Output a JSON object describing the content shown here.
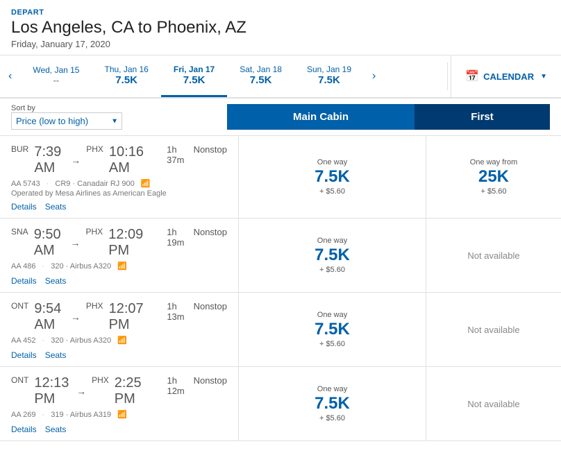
{
  "header": {
    "depart_label": "DEPART",
    "route": "Los Angeles, CA to Phoenix, AZ",
    "date": "Friday, January 17, 2020"
  },
  "date_nav": {
    "prev_arrow": "‹",
    "next_arrow": "›",
    "dates": [
      {
        "id": "wed-jan-15",
        "label": "Wed, Jan 15",
        "price": "--",
        "active": false,
        "price_dashes": true
      },
      {
        "id": "thu-jan-16",
        "label": "Thu, Jan 16",
        "price": "7.5K",
        "active": false,
        "price_dashes": false
      },
      {
        "id": "fri-jan-17",
        "label": "Fri, Jan 17",
        "price": "7.5K",
        "active": true,
        "price_dashes": false
      },
      {
        "id": "sat-jan-18",
        "label": "Sat, Jan 18",
        "price": "7.5K",
        "active": false,
        "price_dashes": false
      },
      {
        "id": "sun-jan-19",
        "label": "Sun, Jan 19",
        "price": "7.5K",
        "active": false,
        "price_dashes": false
      }
    ],
    "calendar_label": "CALENDAR"
  },
  "filters": {
    "sort_label": "Sort by",
    "sort_value": "Price (low to high)"
  },
  "cabin_headers": {
    "main": "Main Cabin",
    "first": "First"
  },
  "flights": [
    {
      "id": "flight-1",
      "origin": "BUR",
      "depart_time": "7:39 AM",
      "dest": "PHX",
      "arrive_time": "10:16 AM",
      "duration": "1h 37m",
      "stops": "Nonstop",
      "flight_num": "AA 5743",
      "aircraft": "CR9 · Canadair RJ 900",
      "wifi": true,
      "operated": "Operated by Mesa Airlines as American Eagle",
      "main_cabin": {
        "one_way": "One way",
        "points": "7.5K",
        "fee": "+ $5.60",
        "available": true,
        "from": false
      },
      "first": {
        "one_way": "One way from",
        "points": "25K",
        "fee": "+ $5.60",
        "available": true,
        "from": true
      }
    },
    {
      "id": "flight-2",
      "origin": "SNA",
      "depart_time": "9:50 AM",
      "dest": "PHX",
      "arrive_time": "12:09 PM",
      "duration": "1h 19m",
      "stops": "Nonstop",
      "flight_num": "AA 486",
      "aircraft": "320 · Airbus A320",
      "wifi": true,
      "operated": null,
      "main_cabin": {
        "one_way": "One way",
        "points": "7.5K",
        "fee": "+ $5.60",
        "available": true,
        "from": false
      },
      "first": {
        "available": false,
        "not_available_text": "Not available"
      }
    },
    {
      "id": "flight-3",
      "origin": "ONT",
      "depart_time": "9:54 AM",
      "dest": "PHX",
      "arrive_time": "12:07 PM",
      "duration": "1h 13m",
      "stops": "Nonstop",
      "flight_num": "AA 452",
      "aircraft": "320 · Airbus A320",
      "wifi": true,
      "operated": null,
      "main_cabin": {
        "one_way": "One way",
        "points": "7.5K",
        "fee": "+ $5.60",
        "available": true,
        "from": false
      },
      "first": {
        "available": false,
        "not_available_text": "Not available"
      }
    },
    {
      "id": "flight-4",
      "origin": "ONT",
      "depart_time": "12:13 PM",
      "dest": "PHX",
      "arrive_time": "2:25 PM",
      "duration": "1h 12m",
      "stops": "Nonstop",
      "flight_num": "AA 269",
      "aircraft": "319 · Airbus A319",
      "wifi": true,
      "operated": null,
      "main_cabin": {
        "one_way": "One way",
        "points": "7.5K",
        "fee": "+ $5.60",
        "available": true,
        "from": false
      },
      "first": {
        "available": false,
        "not_available_text": "Not available"
      }
    }
  ],
  "links": {
    "details": "Details",
    "seats": "Seats"
  }
}
